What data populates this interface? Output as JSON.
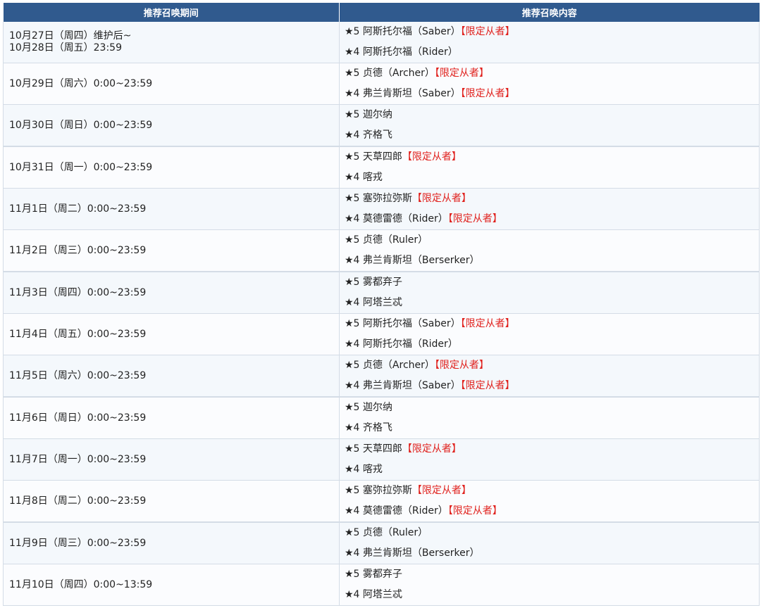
{
  "header": {
    "col1": "推荐召唤期间",
    "col2": "推荐召唤内容"
  },
  "rows": [
    {
      "period": [
        "10月27日（周四）维护后~",
        "10月28日（周五）23:59"
      ],
      "items": [
        {
          "rank": "★5",
          "name": "阿斯托尔福（Saber）",
          "tag": "【限定从者】"
        },
        {
          "rank": "★4",
          "name": "阿斯托尔福（Rider）",
          "tag": ""
        }
      ]
    },
    {
      "period": [
        "10月29日（周六）0:00~23:59"
      ],
      "items": [
        {
          "rank": "★5",
          "name": "贞德（Archer）",
          "tag": "【限定从者】"
        },
        {
          "rank": "★4",
          "name": "弗兰肯斯坦（Saber）",
          "tag": "【限定从者】"
        }
      ]
    },
    {
      "period": [
        "10月30日（周日）0:00~23:59"
      ],
      "items": [
        {
          "rank": "★5",
          "name": "迦尔纳",
          "tag": ""
        },
        {
          "rank": "★4",
          "name": "齐格飞",
          "tag": ""
        }
      ]
    },
    {
      "period": [
        "10月31日（周一）0:00~23:59"
      ],
      "items": [
        {
          "rank": "★5",
          "name": "天草四郎",
          "tag": "【限定从者】"
        },
        {
          "rank": "★4",
          "name": "喀戎",
          "tag": ""
        }
      ]
    },
    {
      "period": [
        "11月1日（周二）0:00~23:59"
      ],
      "items": [
        {
          "rank": "★5",
          "name": "塞弥拉弥斯",
          "tag": "【限定从者】"
        },
        {
          "rank": "★4",
          "name": "莫德雷德（Rider）",
          "tag": "【限定从者】"
        }
      ]
    },
    {
      "period": [
        "11月2日（周三）0:00~23:59"
      ],
      "items": [
        {
          "rank": "★5",
          "name": "贞德（Ruler）",
          "tag": ""
        },
        {
          "rank": "★4",
          "name": "弗兰肯斯坦（Berserker）",
          "tag": ""
        }
      ]
    },
    {
      "period": [
        "11月3日（周四）0:00~23:59"
      ],
      "items": [
        {
          "rank": "★5",
          "name": "雾都弃子",
          "tag": ""
        },
        {
          "rank": "★4",
          "name": "阿塔兰忒",
          "tag": ""
        }
      ]
    },
    {
      "period": [
        "11月4日（周五）0:00~23:59"
      ],
      "items": [
        {
          "rank": "★5",
          "name": "阿斯托尔福（Saber）",
          "tag": "【限定从者】"
        },
        {
          "rank": "★4",
          "name": "阿斯托尔福（Rider）",
          "tag": ""
        }
      ]
    },
    {
      "period": [
        "11月5日（周六）0:00~23:59"
      ],
      "items": [
        {
          "rank": "★5",
          "name": "贞德（Archer）",
          "tag": "【限定从者】"
        },
        {
          "rank": "★4",
          "name": "弗兰肯斯坦（Saber）",
          "tag": "【限定从者】"
        }
      ]
    },
    {
      "period": [
        "11月6日（周日）0:00~23:59"
      ],
      "items": [
        {
          "rank": "★5",
          "name": "迦尔纳",
          "tag": ""
        },
        {
          "rank": "★4",
          "name": "齐格飞",
          "tag": ""
        }
      ]
    },
    {
      "period": [
        "11月7日（周一）0:00~23:59"
      ],
      "items": [
        {
          "rank": "★5",
          "name": "天草四郎",
          "tag": "【限定从者】"
        },
        {
          "rank": "★4",
          "name": "喀戎",
          "tag": ""
        }
      ]
    },
    {
      "period": [
        "11月8日（周二）0:00~23:59"
      ],
      "items": [
        {
          "rank": "★5",
          "name": "塞弥拉弥斯",
          "tag": "【限定从者】"
        },
        {
          "rank": "★4",
          "name": "莫德雷德（Rider）",
          "tag": "【限定从者】"
        }
      ]
    },
    {
      "period": [
        "11月9日（周三）0:00~23:59"
      ],
      "items": [
        {
          "rank": "★5",
          "name": "贞德（Ruler）",
          "tag": ""
        },
        {
          "rank": "★4",
          "name": "弗兰肯斯坦（Berserker）",
          "tag": ""
        }
      ]
    },
    {
      "period": [
        "11月10日（周四）0:00~13:59"
      ],
      "items": [
        {
          "rank": "★5",
          "name": "雾都弃子",
          "tag": ""
        },
        {
          "rank": "★4",
          "name": "阿塔兰忒",
          "tag": ""
        }
      ]
    }
  ],
  "colors": {
    "header_bg": "#305a8e",
    "header_text": "#ffffff",
    "limited_tag": "#e0201c",
    "row_odd": "#f4f8fc",
    "row_even": "#fbfcfe",
    "border": "#d4dce6"
  }
}
